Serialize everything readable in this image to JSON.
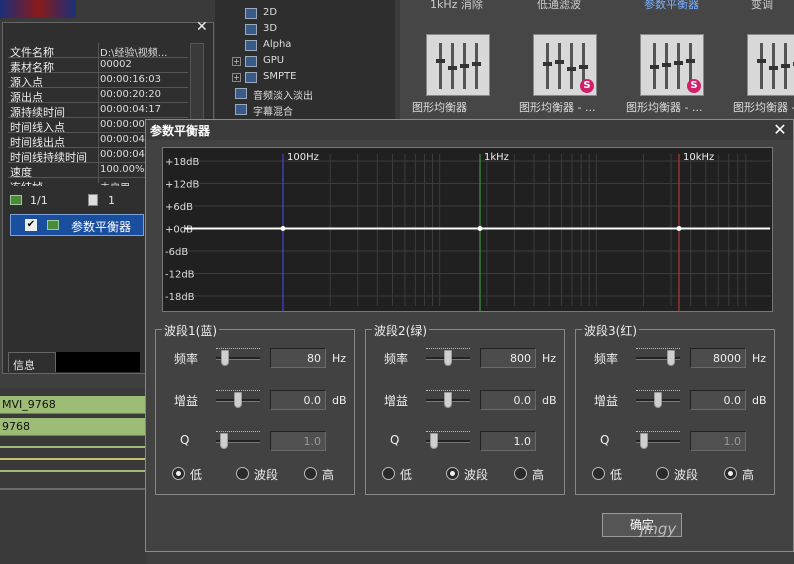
{
  "background": {
    "tree_items": [
      {
        "label": "2D",
        "icon": "transition-icon"
      },
      {
        "label": "3D",
        "icon": "transition-icon"
      },
      {
        "label": "Alpha",
        "icon": "transition-icon"
      },
      {
        "label": "GPU",
        "icon": "transition-icon"
      },
      {
        "label": "SMPTE",
        "icon": "transition-icon"
      },
      {
        "label": "音频淡入淡出",
        "icon": "audio-fade-icon"
      },
      {
        "label": "字幕混合",
        "icon": "title-mix-icon"
      }
    ],
    "effects_headers": [
      "1kHz 消除",
      "低通滤波",
      "参数平衡器",
      "变调"
    ],
    "effects": [
      {
        "label": "图形均衡器"
      },
      {
        "label": "图形均衡器 - ..."
      },
      {
        "label": "图形均衡器 - ..."
      },
      {
        "label": "图形均衡器 - ..."
      }
    ]
  },
  "info_panel": {
    "rows": [
      {
        "key": "文件名称",
        "value": "D:\\经验\\视频..."
      },
      {
        "key": "素材名称",
        "value": "00002"
      },
      {
        "key": "源入点",
        "value": "00:00:16:03"
      },
      {
        "key": "源出点",
        "value": "00:00:20:20"
      },
      {
        "key": "源持续时间",
        "value": "00:00:04:17"
      },
      {
        "key": "时间线入点",
        "value": "00:00:00"
      },
      {
        "key": "时间线出点",
        "value": "00:00:04"
      },
      {
        "key": "时间线持续时间",
        "value": "00:00:04"
      },
      {
        "key": "速度",
        "value": "100.00%"
      },
      {
        "key": "冻结帧",
        "value": "未启用"
      }
    ],
    "filter_page": "1/1",
    "filter_count": "1",
    "effect_item": "参数平衡器",
    "tab_label": "信息"
  },
  "timeline": {
    "clips": [
      "MVI_9768",
      "9768"
    ]
  },
  "dialog": {
    "title": "参数平衡器",
    "graph": {
      "db_labels": [
        "+18dB",
        "+12dB",
        "+6dB",
        "+0dB",
        "-6dB",
        "-12dB",
        "-18dB"
      ],
      "freq_markers": [
        "100Hz",
        "1kHz",
        "10kHz"
      ]
    },
    "bands": [
      {
        "title": "波段1(蓝)",
        "freq_label": "频率",
        "freq_value": "80",
        "freq_unit": "Hz",
        "freq_pos": 0.15,
        "gain_label": "增益",
        "gain_value": "0.0",
        "gain_unit": "dB",
        "gain_pos": 0.5,
        "q_label": "Q",
        "q_value": "1.0",
        "q_pos": 0.1,
        "q_disabled": true,
        "radios": [
          "低",
          "波段",
          "高"
        ],
        "selected": 0
      },
      {
        "title": "波段2(绿)",
        "freq_label": "频率",
        "freq_value": "800",
        "freq_unit": "Hz",
        "freq_pos": 0.5,
        "gain_label": "增益",
        "gain_value": "0.0",
        "gain_unit": "dB",
        "gain_pos": 0.5,
        "q_label": "Q",
        "q_value": "1.0",
        "q_pos": 0.1,
        "q_disabled": false,
        "radios": [
          "低",
          "波段",
          "高"
        ],
        "selected": 1
      },
      {
        "title": "波段3(红)",
        "freq_label": "频率",
        "freq_value": "8000",
        "freq_unit": "Hz",
        "freq_pos": 0.85,
        "gain_label": "增益",
        "gain_value": "0.0",
        "gain_unit": "dB",
        "gain_pos": 0.5,
        "q_label": "Q",
        "q_value": "1.0",
        "q_pos": 0.1,
        "q_disabled": true,
        "radios": [
          "低",
          "波段",
          "高"
        ],
        "selected": 2
      }
    ],
    "ok_label": "确定",
    "watermark": "jingy"
  },
  "colors": {
    "band1": "#4a4aff",
    "band2": "#40b040",
    "band3": "#d03a3a"
  }
}
